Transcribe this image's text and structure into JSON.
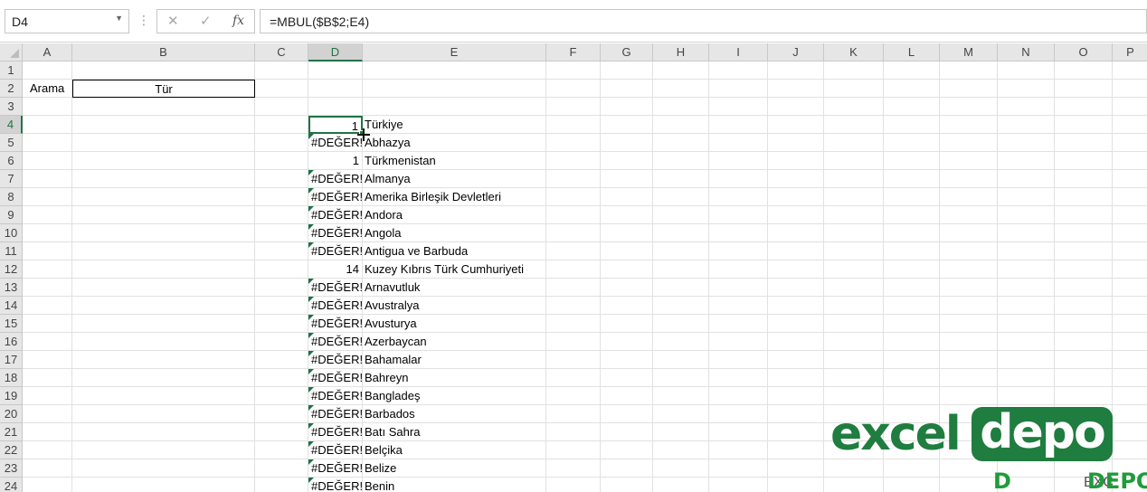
{
  "formula_bar": {
    "name_box": "D4",
    "cancel_glyph": "✕",
    "enter_glyph": "✓",
    "fx_label": "fx",
    "formula": "=MBUL($B$2;E4)"
  },
  "columns": [
    "A",
    "B",
    "C",
    "D",
    "E",
    "F",
    "G",
    "H",
    "I",
    "J",
    "K",
    "L",
    "M",
    "N",
    "O",
    "P"
  ],
  "rows": [
    "1",
    "2",
    "3",
    "4",
    "5",
    "6",
    "7",
    "8",
    "9",
    "10",
    "11",
    "12",
    "13",
    "14",
    "15",
    "16",
    "17",
    "18",
    "19",
    "20",
    "21",
    "22",
    "23",
    "24"
  ],
  "active_cell": "D4",
  "cells": {
    "A2": "Arama",
    "B2": "Tür",
    "D": [
      "1",
      "#DEĞER!",
      "1",
      "#DEĞER!",
      "#DEĞER!",
      "#DEĞER!",
      "#DEĞER!",
      "#DEĞER!",
      "14",
      "#DEĞER!",
      "#DEĞER!",
      "#DEĞER!",
      "#DEĞER!",
      "#DEĞER!",
      "#DEĞER!",
      "#DEĞER!",
      "#DEĞER!",
      "#DEĞER!",
      "#DEĞER!",
      "#DEĞER!",
      "#DEĞER!"
    ],
    "E": [
      "Türkiye",
      "Abhazya",
      "Türkmenistan",
      "Almanya",
      "Amerika Birleşik Devletleri",
      "Andora",
      "Angola",
      "Antigua ve Barbuda",
      "Kuzey Kıbrıs Türk Cumhuriyeti",
      "Arnavutluk",
      "Avustralya",
      "Avusturya",
      "Azerbaycan",
      "Bahamalar",
      "Bahreyn",
      "Bangladeş",
      "Barbados",
      "Batı Sahra",
      "Belçika",
      "Belize",
      "Benin"
    ]
  },
  "watermark": {
    "logo_part1": "excel",
    "logo_part2": "depo",
    "small_logo_d": "D",
    "small_text": "EXC",
    "small_logo_depo": "DEPO"
  },
  "colors": {
    "accent": "#217346",
    "error_indicator": "#1e7145",
    "logo_green": "#1f7d3f"
  }
}
